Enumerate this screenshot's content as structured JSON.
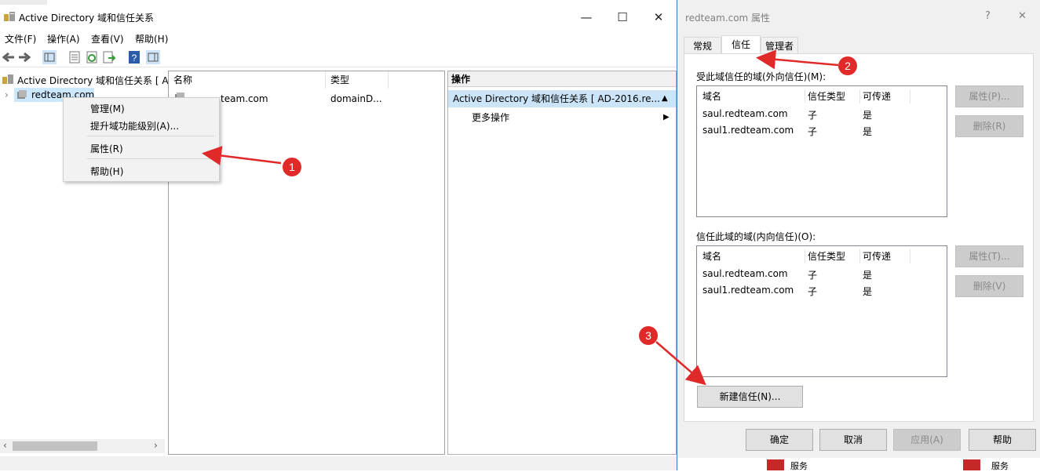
{
  "mmc": {
    "title": "Active Directory 域和信任关系",
    "menu": [
      "文件(F)",
      "操作(A)",
      "查看(V)",
      "帮助(H)"
    ],
    "tree": {
      "root_label": "Active Directory 域和信任关系 [ A",
      "child_label": "redteam.com"
    },
    "list": {
      "col_name": "名称",
      "col_type": "类型",
      "row_name": "team.com",
      "row_type": "domainD..."
    },
    "ops": {
      "header": "操作",
      "selected": "Active Directory 域和信任关系 [ AD-2016.re...",
      "more": "更多操作"
    },
    "context_menu": [
      "管理(M)",
      "提升域功能级别(A)...",
      "属性(R)",
      "帮助(H)"
    ]
  },
  "dialog": {
    "title": "redteam.com 属性",
    "help_glyph": "?",
    "close_glyph": "✕",
    "tabs": [
      "常规",
      "信任",
      "管理者"
    ],
    "outgoing_label": "受此域信任的域(外向信任)(M):",
    "incoming_label": "信任此域的域(内向信任)(O):",
    "columns": [
      "域名",
      "信任类型",
      "可传递"
    ],
    "outgoing_rows": [
      [
        "saul.redteam.com",
        "子",
        "是"
      ],
      [
        "saul1.redteam.com",
        "子",
        "是"
      ]
    ],
    "incoming_rows": [
      [
        "saul.redteam.com",
        "子",
        "是"
      ],
      [
        "saul1.redteam.com",
        "子",
        "是"
      ]
    ],
    "btn_props_out": "属性(P)...",
    "btn_remove_out": "删除(R)",
    "btn_props_in": "属性(T)...",
    "btn_remove_in": "删除(V)",
    "btn_new_trust": "新建信任(N)...",
    "footer": [
      "确定",
      "取消",
      "应用(A)",
      "帮助"
    ]
  },
  "taskbar_text": [
    "服务",
    "服务"
  ],
  "annotations": [
    "1",
    "2",
    "3"
  ],
  "colors": {
    "accent": "#3b78c4",
    "annotation_red": "#e02a2a",
    "selected_ops": "#cce4f7"
  }
}
